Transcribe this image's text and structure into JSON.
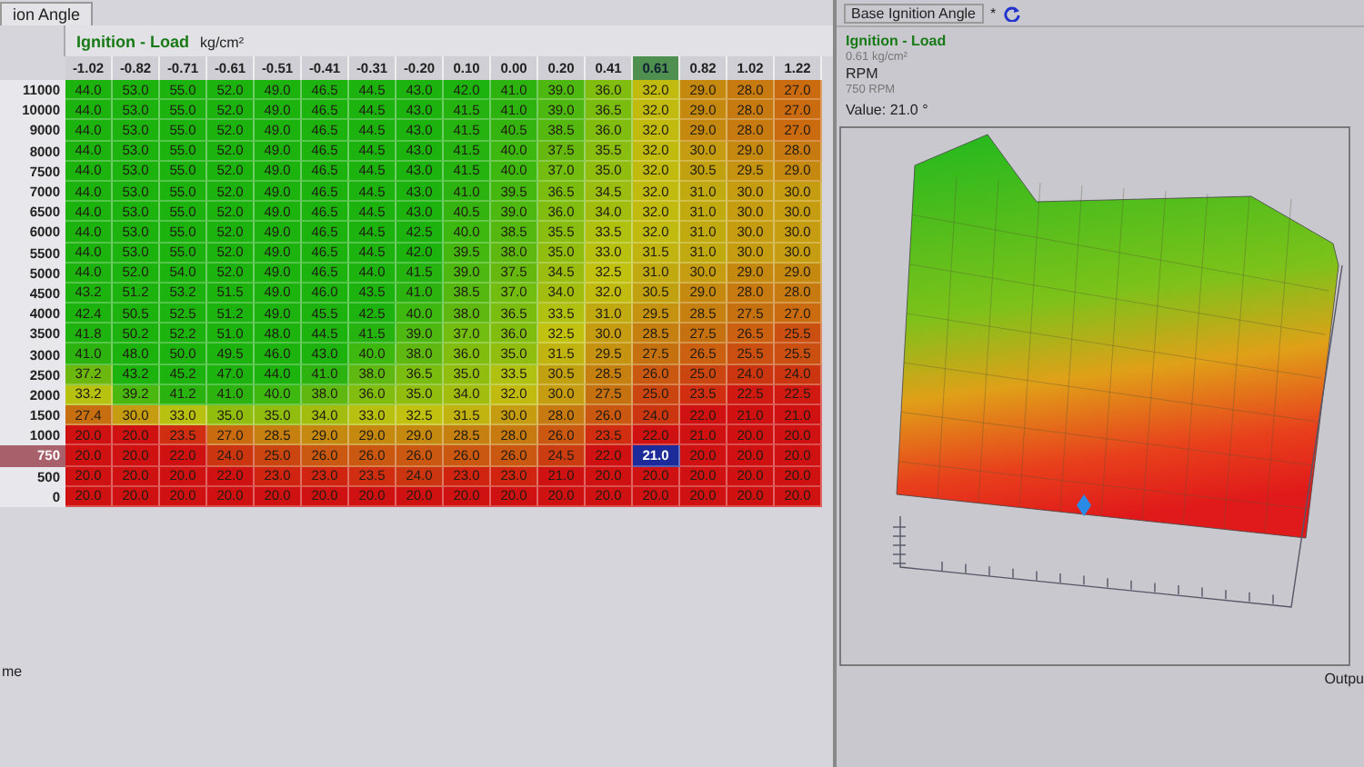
{
  "left_tab": {
    "label": "ion Angle"
  },
  "table": {
    "title": "Ignition - Load",
    "unit": "kg/cm²",
    "columns": [
      {
        "label": "-1.02",
        "selected": false
      },
      {
        "label": "-0.82",
        "selected": false
      },
      {
        "label": "-0.71",
        "selected": false
      },
      {
        "label": "-0.61",
        "selected": false
      },
      {
        "label": "-0.51",
        "selected": false
      },
      {
        "label": "-0.41",
        "selected": false
      },
      {
        "label": "-0.31",
        "selected": false
      },
      {
        "label": "-0.20",
        "selected": false
      },
      {
        "label": "0.10",
        "selected": false
      },
      {
        "label": "0.00",
        "selected": false
      },
      {
        "label": "0.20",
        "selected": false
      },
      {
        "label": "0.41",
        "selected": false
      },
      {
        "label": "0.61",
        "selected": true
      },
      {
        "label": "0.82",
        "selected": false
      },
      {
        "label": "1.02",
        "selected": false
      },
      {
        "label": "1.22",
        "selected": false
      }
    ],
    "rows": [
      {
        "label": "11000",
        "selected": false,
        "cells": [
          "44.0",
          "53.0",
          "55.0",
          "52.0",
          "49.0",
          "46.5",
          "44.5",
          "43.0",
          "42.0",
          "41.0",
          "39.0",
          "36.0",
          "32.0",
          "29.0",
          "28.0",
          "27.0"
        ]
      },
      {
        "label": "10000",
        "selected": false,
        "cells": [
          "44.0",
          "53.0",
          "55.0",
          "52.0",
          "49.0",
          "46.5",
          "44.5",
          "43.0",
          "41.5",
          "41.0",
          "39.0",
          "36.5",
          "32.0",
          "29.0",
          "28.0",
          "27.0"
        ]
      },
      {
        "label": "9000",
        "selected": false,
        "cells": [
          "44.0",
          "53.0",
          "55.0",
          "52.0",
          "49.0",
          "46.5",
          "44.5",
          "43.0",
          "41.5",
          "40.5",
          "38.5",
          "36.0",
          "32.0",
          "29.0",
          "28.0",
          "27.0"
        ]
      },
      {
        "label": "8000",
        "selected": false,
        "cells": [
          "44.0",
          "53.0",
          "55.0",
          "52.0",
          "49.0",
          "46.5",
          "44.5",
          "43.0",
          "41.5",
          "40.0",
          "37.5",
          "35.5",
          "32.0",
          "30.0",
          "29.0",
          "28.0"
        ]
      },
      {
        "label": "7500",
        "selected": false,
        "cells": [
          "44.0",
          "53.0",
          "55.0",
          "52.0",
          "49.0",
          "46.5",
          "44.5",
          "43.0",
          "41.5",
          "40.0",
          "37.0",
          "35.0",
          "32.0",
          "30.5",
          "29.5",
          "29.0"
        ]
      },
      {
        "label": "7000",
        "selected": false,
        "cells": [
          "44.0",
          "53.0",
          "55.0",
          "52.0",
          "49.0",
          "46.5",
          "44.5",
          "43.0",
          "41.0",
          "39.5",
          "36.5",
          "34.5",
          "32.0",
          "31.0",
          "30.0",
          "30.0"
        ]
      },
      {
        "label": "6500",
        "selected": false,
        "cells": [
          "44.0",
          "53.0",
          "55.0",
          "52.0",
          "49.0",
          "46.5",
          "44.5",
          "43.0",
          "40.5",
          "39.0",
          "36.0",
          "34.0",
          "32.0",
          "31.0",
          "30.0",
          "30.0"
        ]
      },
      {
        "label": "6000",
        "selected": false,
        "cells": [
          "44.0",
          "53.0",
          "55.0",
          "52.0",
          "49.0",
          "46.5",
          "44.5",
          "42.5",
          "40.0",
          "38.5",
          "35.5",
          "33.5",
          "32.0",
          "31.0",
          "30.0",
          "30.0"
        ]
      },
      {
        "label": "5500",
        "selected": false,
        "cells": [
          "44.0",
          "53.0",
          "55.0",
          "52.0",
          "49.0",
          "46.5",
          "44.5",
          "42.0",
          "39.5",
          "38.0",
          "35.0",
          "33.0",
          "31.5",
          "31.0",
          "30.0",
          "30.0"
        ]
      },
      {
        "label": "5000",
        "selected": false,
        "cells": [
          "44.0",
          "52.0",
          "54.0",
          "52.0",
          "49.0",
          "46.5",
          "44.0",
          "41.5",
          "39.0",
          "37.5",
          "34.5",
          "32.5",
          "31.0",
          "30.0",
          "29.0",
          "29.0"
        ]
      },
      {
        "label": "4500",
        "selected": false,
        "cells": [
          "43.2",
          "51.2",
          "53.2",
          "51.5",
          "49.0",
          "46.0",
          "43.5",
          "41.0",
          "38.5",
          "37.0",
          "34.0",
          "32.0",
          "30.5",
          "29.0",
          "28.0",
          "28.0"
        ]
      },
      {
        "label": "4000",
        "selected": false,
        "cells": [
          "42.4",
          "50.5",
          "52.5",
          "51.2",
          "49.0",
          "45.5",
          "42.5",
          "40.0",
          "38.0",
          "36.5",
          "33.5",
          "31.0",
          "29.5",
          "28.5",
          "27.5",
          "27.0"
        ]
      },
      {
        "label": "3500",
        "selected": false,
        "cells": [
          "41.8",
          "50.2",
          "52.2",
          "51.0",
          "48.0",
          "44.5",
          "41.5",
          "39.0",
          "37.0",
          "36.0",
          "32.5",
          "30.0",
          "28.5",
          "27.5",
          "26.5",
          "25.5"
        ]
      },
      {
        "label": "3000",
        "selected": false,
        "cells": [
          "41.0",
          "48.0",
          "50.0",
          "49.5",
          "46.0",
          "43.0",
          "40.0",
          "38.0",
          "36.0",
          "35.0",
          "31.5",
          "29.5",
          "27.5",
          "26.5",
          "25.5",
          "25.5"
        ]
      },
      {
        "label": "2500",
        "selected": false,
        "cells": [
          "37.2",
          "43.2",
          "45.2",
          "47.0",
          "44.0",
          "41.0",
          "38.0",
          "36.5",
          "35.0",
          "33.5",
          "30.5",
          "28.5",
          "26.0",
          "25.0",
          "24.0",
          "24.0"
        ]
      },
      {
        "label": "2000",
        "selected": false,
        "cells": [
          "33.2",
          "39.2",
          "41.2",
          "41.0",
          "40.0",
          "38.0",
          "36.0",
          "35.0",
          "34.0",
          "32.0",
          "30.0",
          "27.5",
          "25.0",
          "23.5",
          "22.5",
          "22.5"
        ]
      },
      {
        "label": "1500",
        "selected": false,
        "cells": [
          "27.4",
          "30.0",
          "33.0",
          "35.0",
          "35.0",
          "34.0",
          "33.0",
          "32.5",
          "31.5",
          "30.0",
          "28.0",
          "26.0",
          "24.0",
          "22.0",
          "21.0",
          "21.0"
        ]
      },
      {
        "label": "1000",
        "selected": false,
        "cells": [
          "20.0",
          "20.0",
          "23.5",
          "27.0",
          "28.5",
          "29.0",
          "29.0",
          "29.0",
          "28.5",
          "28.0",
          "26.0",
          "23.5",
          "22.0",
          "21.0",
          "20.0",
          "20.0"
        ]
      },
      {
        "label": "750",
        "selected": true,
        "cells": [
          "20.0",
          "20.0",
          "22.0",
          "24.0",
          "25.0",
          "26.0",
          "26.0",
          "26.0",
          "26.0",
          "26.0",
          "24.5",
          "22.0",
          "21.0",
          "20.0",
          "20.0",
          "20.0"
        ]
      },
      {
        "label": "500",
        "selected": false,
        "cells": [
          "20.0",
          "20.0",
          "20.0",
          "22.0",
          "23.0",
          "23.0",
          "23.5",
          "24.0",
          "23.0",
          "23.0",
          "21.0",
          "20.0",
          "20.0",
          "20.0",
          "20.0",
          "20.0"
        ]
      },
      {
        "label": "0",
        "selected": false,
        "cells": [
          "20.0",
          "20.0",
          "20.0",
          "20.0",
          "20.0",
          "20.0",
          "20.0",
          "20.0",
          "20.0",
          "20.0",
          "20.0",
          "20.0",
          "20.0",
          "20.0",
          "20.0",
          "20.0"
        ]
      }
    ]
  },
  "footer_text": "me",
  "view": {
    "tab": "Base Ignition Angle",
    "tab_close": "*",
    "info": {
      "axis_1": "Ignition - Load",
      "axis_1_value": "0.61 kg/cm²",
      "axis_2": "RPM",
      "axis_2_value": "750 RPM",
      "value": "Value: 21.0 °"
    },
    "axis_label": "Outpu"
  }
}
